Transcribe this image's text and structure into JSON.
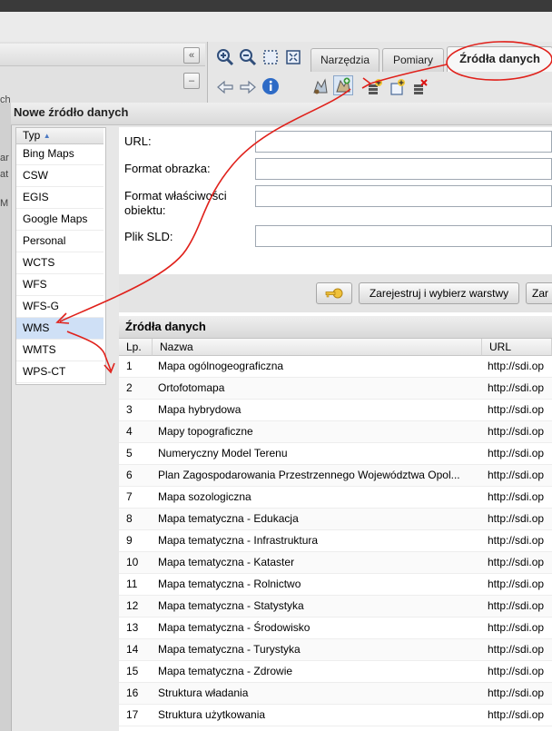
{
  "window": {
    "title": ""
  },
  "toolbar": {
    "tabs": [
      {
        "label": "Narzędzia"
      },
      {
        "label": "Pomiary"
      },
      {
        "label": "Źródła danych",
        "active": true
      }
    ],
    "icons": [
      "zoom-in-icon",
      "zoom-out-icon",
      "zoom-box-icon",
      "zoom-extent-icon",
      "back-arrow-icon",
      "forward-arrow-icon",
      "info-icon",
      "data-source-icon",
      "add-data-source-icon",
      "add-layer-icon",
      "add-layer-group-icon",
      "remove-layer-icon"
    ],
    "collapse_label": "«",
    "minimize_label": "–"
  },
  "side_edge": {
    "snippets": [
      "ch",
      "ar",
      "at",
      "M"
    ]
  },
  "dialog": {
    "title": "Nowe źródło danych",
    "type_list": {
      "header": "Typ",
      "sort": "ascending",
      "items": [
        "Bing Maps",
        "CSW",
        "EGIS",
        "Google Maps",
        "Personal",
        "WCTS",
        "WFS",
        "WFS-G",
        "WMS",
        "WMTS",
        "WPS-CT"
      ],
      "selected": "WMS"
    },
    "form": {
      "url_label": "URL:",
      "url_value": "",
      "format_label": "Format obrazka:",
      "format_value": "",
      "feature_format_label_1": "Format właściwości",
      "feature_format_label_2": "obiektu:",
      "feature_format_value": "",
      "sld_label": "Plik SLD:",
      "sld_value": ""
    },
    "buttons": {
      "key_icon": "key-icon",
      "register_label": "Zarejestruj i wybierz warstwy",
      "more_label": "Zar"
    },
    "grid": {
      "title": "Źródła danych",
      "columns": {
        "lp": "Lp.",
        "name": "Nazwa",
        "url": "URL"
      },
      "rows": [
        {
          "lp": "1",
          "name": "Mapa ogólnogeograficzna",
          "url": "http://sdi.op"
        },
        {
          "lp": "2",
          "name": "Ortofotomapa",
          "url": "http://sdi.op"
        },
        {
          "lp": "3",
          "name": "Mapa hybrydowa",
          "url": "http://sdi.op"
        },
        {
          "lp": "4",
          "name": "Mapy topograficzne",
          "url": "http://sdi.op"
        },
        {
          "lp": "5",
          "name": "Numeryczny Model Terenu",
          "url": "http://sdi.op"
        },
        {
          "lp": "6",
          "name": "Plan Zagospodarowania Przestrzennego Województwa Opol...",
          "url": "http://sdi.op"
        },
        {
          "lp": "7",
          "name": "Mapa sozologiczna",
          "url": "http://sdi.op"
        },
        {
          "lp": "8",
          "name": "Mapa tematyczna - Edukacja",
          "url": "http://sdi.op"
        },
        {
          "lp": "9",
          "name": "Mapa tematyczna - Infrastruktura",
          "url": "http://sdi.op"
        },
        {
          "lp": "10",
          "name": "Mapa tematyczna - Kataster",
          "url": "http://sdi.op"
        },
        {
          "lp": "11",
          "name": "Mapa tematyczna - Rolnictwo",
          "url": "http://sdi.op"
        },
        {
          "lp": "12",
          "name": "Mapa tematyczna - Statystyka",
          "url": "http://sdi.op"
        },
        {
          "lp": "13",
          "name": "Mapa tematyczna - Środowisko",
          "url": "http://sdi.op"
        },
        {
          "lp": "14",
          "name": "Mapa tematyczna - Turystyka",
          "url": "http://sdi.op"
        },
        {
          "lp": "15",
          "name": "Mapa tematyczna - Zdrowie",
          "url": "http://sdi.op"
        },
        {
          "lp": "16",
          "name": "Struktura władania",
          "url": "http://sdi.op"
        },
        {
          "lp": "17",
          "name": "Struktura użytkowania",
          "url": "http://sdi.op"
        }
      ]
    }
  },
  "annotation": {
    "color": "#e0211b"
  }
}
